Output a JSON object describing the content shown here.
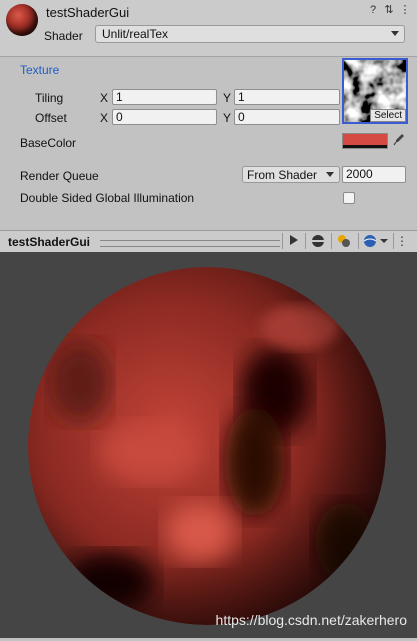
{
  "header": {
    "title": "testShaderGui",
    "shader_label": "Shader",
    "shader_value": "Unlit/realTex",
    "icons": [
      "help-icon",
      "preset-icon",
      "more-icon"
    ]
  },
  "properties": {
    "texture_label": "Texture",
    "tiling": {
      "label": "Tiling",
      "x_label": "X",
      "x": "1",
      "y_label": "Y",
      "y": "1"
    },
    "offset": {
      "label": "Offset",
      "x_label": "X",
      "x": "0",
      "y_label": "Y",
      "y": "0"
    },
    "texture_select_label": "Select",
    "basecolor_label": "BaseColor",
    "basecolor_hex": "#d54a43",
    "render_queue_label": "Render Queue",
    "render_queue_mode": "From Shader",
    "render_queue_value": "2000",
    "gi_label": "Double Sided Global Illumination",
    "gi_checked": false
  },
  "preview": {
    "title": "testShaderGui",
    "toolbar_icons": [
      "play-icon",
      "sphere-icon",
      "light-icon",
      "mesh-dropdown-icon",
      "more-icon"
    ],
    "watermark": "https://blog.csdn.net/zakerhero"
  }
}
